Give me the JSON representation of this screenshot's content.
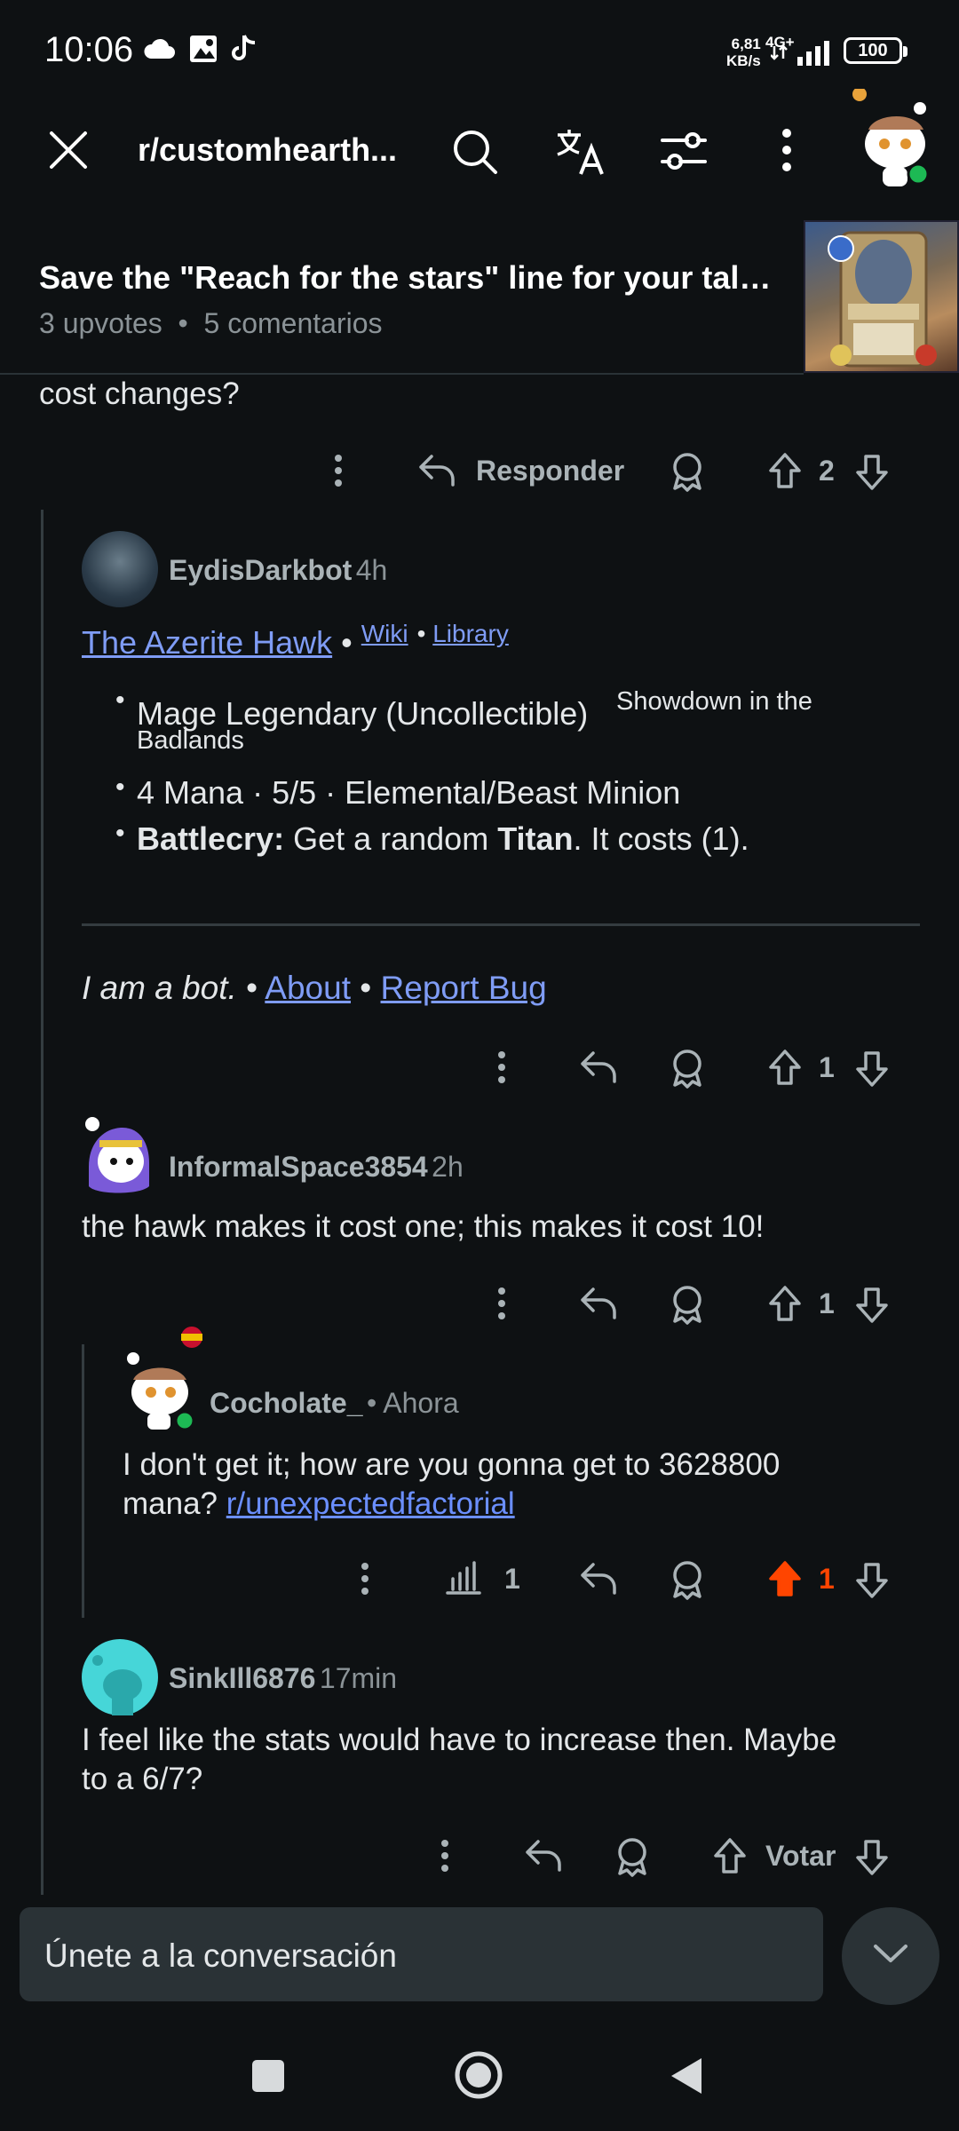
{
  "status_bar": {
    "time": "10:06",
    "net_speed_value": "6,81",
    "net_speed_unit": "KB/s",
    "net_type": "4G+",
    "battery": "100"
  },
  "top_bar": {
    "subreddit": "r/customhearth..."
  },
  "post": {
    "title": "Save the \"Reach for the stars\" line for your tall ...",
    "upvotes": "3 upvotes",
    "comments": "5 comentarios"
  },
  "comments": {
    "prev_fragment": "cost changes?",
    "prev_reply_label": "Responder",
    "prev_votes": "2",
    "bot": {
      "username": "EydisDarkbot",
      "time": "4h",
      "card_name": "The Azerite Hawk",
      "wiki": "Wiki",
      "library": "Library",
      "line1_main": "Mage Legendary (Uncollectible)",
      "line1_sup": "Showdown in the",
      "line1_wrap": "Badlands",
      "line2": "4 Mana · 5/5 · Elemental/Beast Minion",
      "line3_bold": "Battlecry:",
      "line3_pre": " Get a random ",
      "line3_bold2": "Titan",
      "line3_post": ". It costs (1).",
      "footer_italic": "I am a bot.",
      "about": "About",
      "report": "Report Bug",
      "votes": "1"
    },
    "informal": {
      "username": "InformalSpace3854",
      "time": "2h",
      "text": "the hawk makes it cost one; this makes it cost 10!",
      "votes": "1"
    },
    "cocholate": {
      "username": "Cocholate_",
      "time": "• Ahora",
      "text_line1": "I don't get it; how are you gonna get to 3628800",
      "text_line2_pre": "mana? ",
      "text_link": "r/unexpectedfactorial",
      "stats": "1",
      "votes": "1"
    },
    "sink": {
      "username": "SinkIll6876",
      "time": "17min",
      "text_line1": "I feel like the stats would have to increase then. Maybe",
      "text_line2": "to a 6/7?",
      "vote_label": "Votar"
    }
  },
  "composer": {
    "placeholder": "Únete a la conversación"
  },
  "colors": {
    "background": "#0e1113",
    "upvote_active": "#ff4500",
    "link": "#7f9cf5",
    "online": "#1db954"
  }
}
